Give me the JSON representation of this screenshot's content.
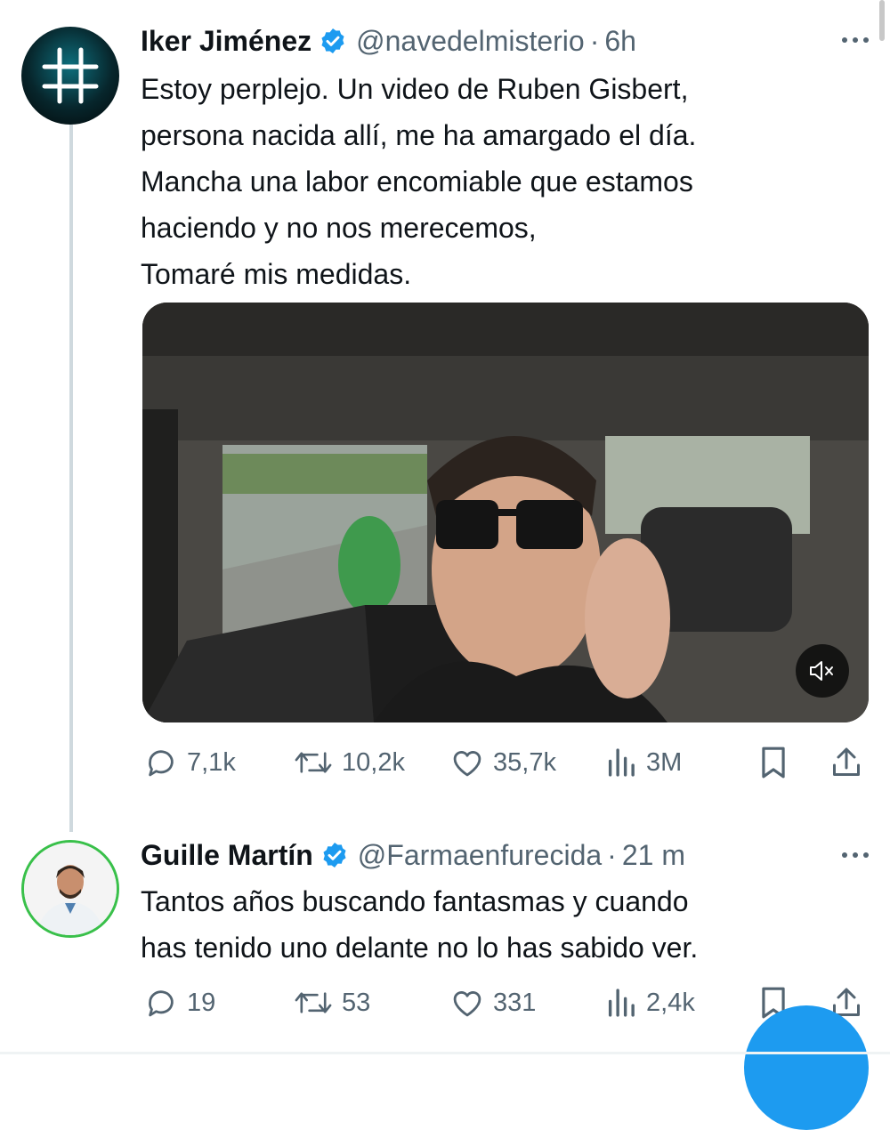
{
  "tweets": [
    {
      "name": "Iker Jiménez",
      "handle": "@navedelmisterio",
      "separator": "·",
      "time": "6h",
      "text": "Estoy perplejo. Un video de Ruben Gisbert,\npersona nacida allí,  me ha amargado el día.\nMancha una labor encomiable que estamos\nhaciendo y no nos merecemos,\nTomaré mis medidas.",
      "avatar_icon": "hashtag-icon",
      "stats": {
        "replies": "7,1k",
        "retweets": "10,2k",
        "likes": "35,7k",
        "views": "3M"
      }
    },
    {
      "name": "Guille Martín",
      "handle": "@Farmaenfurecida",
      "separator": "·",
      "time": "21 m",
      "text": "Tantos años buscando fantasmas y cuando\nhas tenido uno delante no lo has sabido ver.",
      "avatar_icon": "person-photo",
      "stats": {
        "replies": "19",
        "retweets": "53",
        "likes": "331",
        "views": "2,4k"
      }
    }
  ],
  "colors": {
    "accent": "#1d9bf0",
    "text": "#0f1419",
    "muted": "#536471"
  }
}
